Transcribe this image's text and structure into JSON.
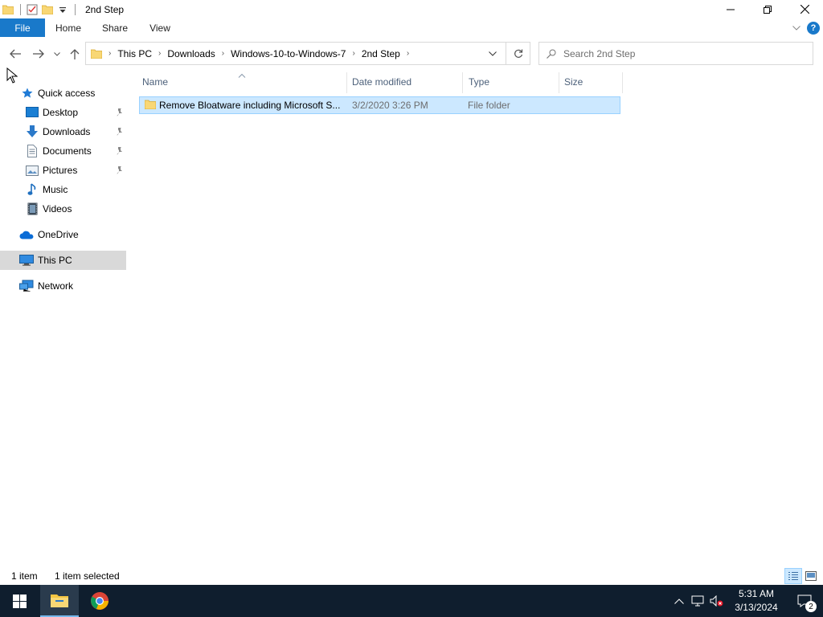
{
  "window": {
    "title": "2nd Step"
  },
  "ribbon": {
    "tabs": [
      "File",
      "Home",
      "Share",
      "View"
    ],
    "help_label": "?"
  },
  "address": {
    "crumbs": [
      "This PC",
      "Downloads",
      "Windows-10-to-Windows-7",
      "2nd Step"
    ]
  },
  "search": {
    "placeholder": "Search 2nd Step"
  },
  "nav": {
    "quick_access": "Quick access",
    "items": [
      {
        "label": "Desktop",
        "icon": "desktop-icon",
        "pinned": true
      },
      {
        "label": "Downloads",
        "icon": "downloads-icon",
        "pinned": true
      },
      {
        "label": "Documents",
        "icon": "documents-icon",
        "pinned": true
      },
      {
        "label": "Pictures",
        "icon": "pictures-icon",
        "pinned": true
      },
      {
        "label": "Music",
        "icon": "music-icon",
        "pinned": false
      },
      {
        "label": "Videos",
        "icon": "videos-icon",
        "pinned": false
      }
    ],
    "onedrive": "OneDrive",
    "this_pc": "This PC",
    "network": "Network"
  },
  "columns": {
    "name": "Name",
    "date": "Date modified",
    "type": "Type",
    "size": "Size"
  },
  "files": [
    {
      "name": "Remove Bloatware including Microsoft S...",
      "date": "3/2/2020 3:26 PM",
      "type": "File folder",
      "size": ""
    }
  ],
  "status": {
    "count": "1 item",
    "selected": "1 item selected"
  },
  "taskbar": {
    "time": "5:31 AM",
    "date": "3/13/2024",
    "notifications": "2"
  },
  "colors": {
    "accent": "#1979ca",
    "selection": "#cce8ff",
    "selection_border": "#99d1ff",
    "taskbar": "#0f1e2e"
  }
}
